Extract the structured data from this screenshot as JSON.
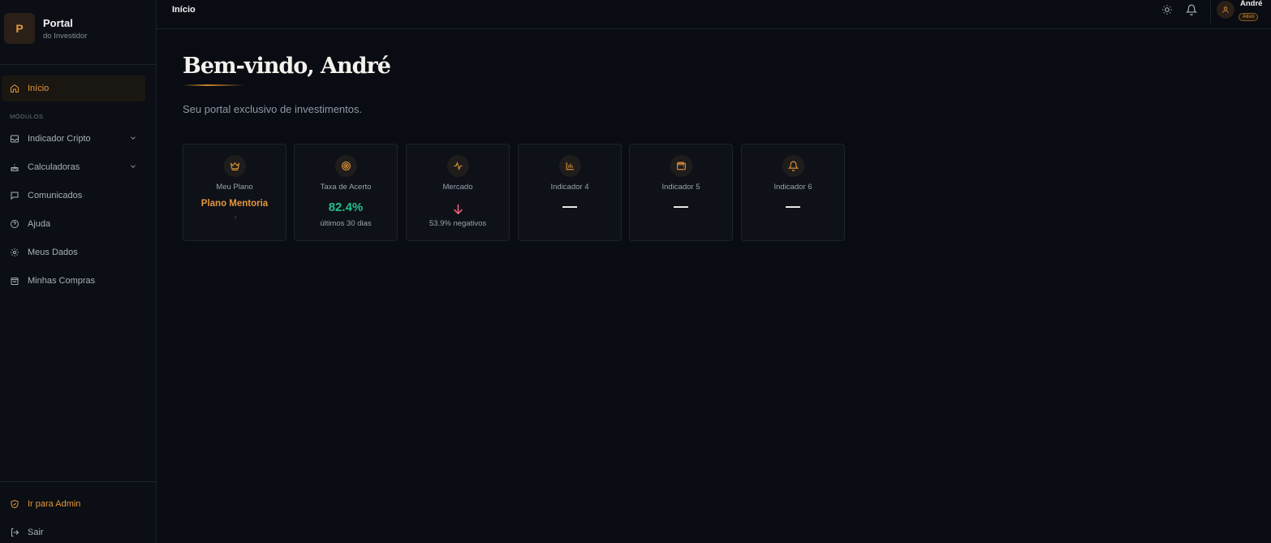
{
  "brand": {
    "initial": "P",
    "title": "Portal",
    "subtitle": "do Investidor"
  },
  "sidebar": {
    "active_item": {
      "label": "Início",
      "icon": "home-icon"
    },
    "section_label": "MÓDULOS",
    "items": [
      {
        "label": "Indicador Cripto",
        "icon": "inbox-icon",
        "expandable": true
      },
      {
        "label": "Calculadoras",
        "icon": "cake-icon",
        "expandable": true
      },
      {
        "label": "Comunicados",
        "icon": "chat-icon",
        "expandable": false
      },
      {
        "label": "Ajuda",
        "icon": "help-icon",
        "expandable": false
      },
      {
        "label": "Meus Dados",
        "icon": "gear-icon",
        "expandable": false
      },
      {
        "label": "Minhas Compras",
        "icon": "shopping-bag-icon",
        "expandable": false
      }
    ],
    "footer": [
      {
        "label": "Ir para Admin",
        "icon": "shield-icon"
      },
      {
        "label": "Sair",
        "icon": "logout-icon"
      }
    ]
  },
  "topbar": {
    "page_title": "Início",
    "user": {
      "name": "André",
      "status": "Ativo"
    }
  },
  "main": {
    "welcome": "Bem-vindo, André",
    "subtitle": "Seu portal exclusivo de investimentos.",
    "cards": [
      {
        "label": "Meu Plano",
        "value": "Plano Mentoria",
        "sub": "",
        "icon": "crown-icon"
      },
      {
        "label": "Taxa de Acerto",
        "value": "82.4%",
        "sub": "últimos 30 dias",
        "icon": "target-icon"
      },
      {
        "label": "Mercado",
        "value": "",
        "sub": "53.9% negativos",
        "icon": "activity-icon",
        "trend": "down"
      },
      {
        "label": "Indicador 4",
        "value": "—",
        "sub": "",
        "icon": "bar-chart-icon"
      },
      {
        "label": "Indicador 5",
        "value": "—",
        "sub": "",
        "icon": "wallet-icon"
      },
      {
        "label": "Indicador 6",
        "value": "—",
        "sub": "",
        "icon": "bell-icon"
      }
    ]
  },
  "colors": {
    "accent": "#e5963a",
    "positive": "#22c08a",
    "negative": "#f0607a",
    "background": "#090c12"
  }
}
